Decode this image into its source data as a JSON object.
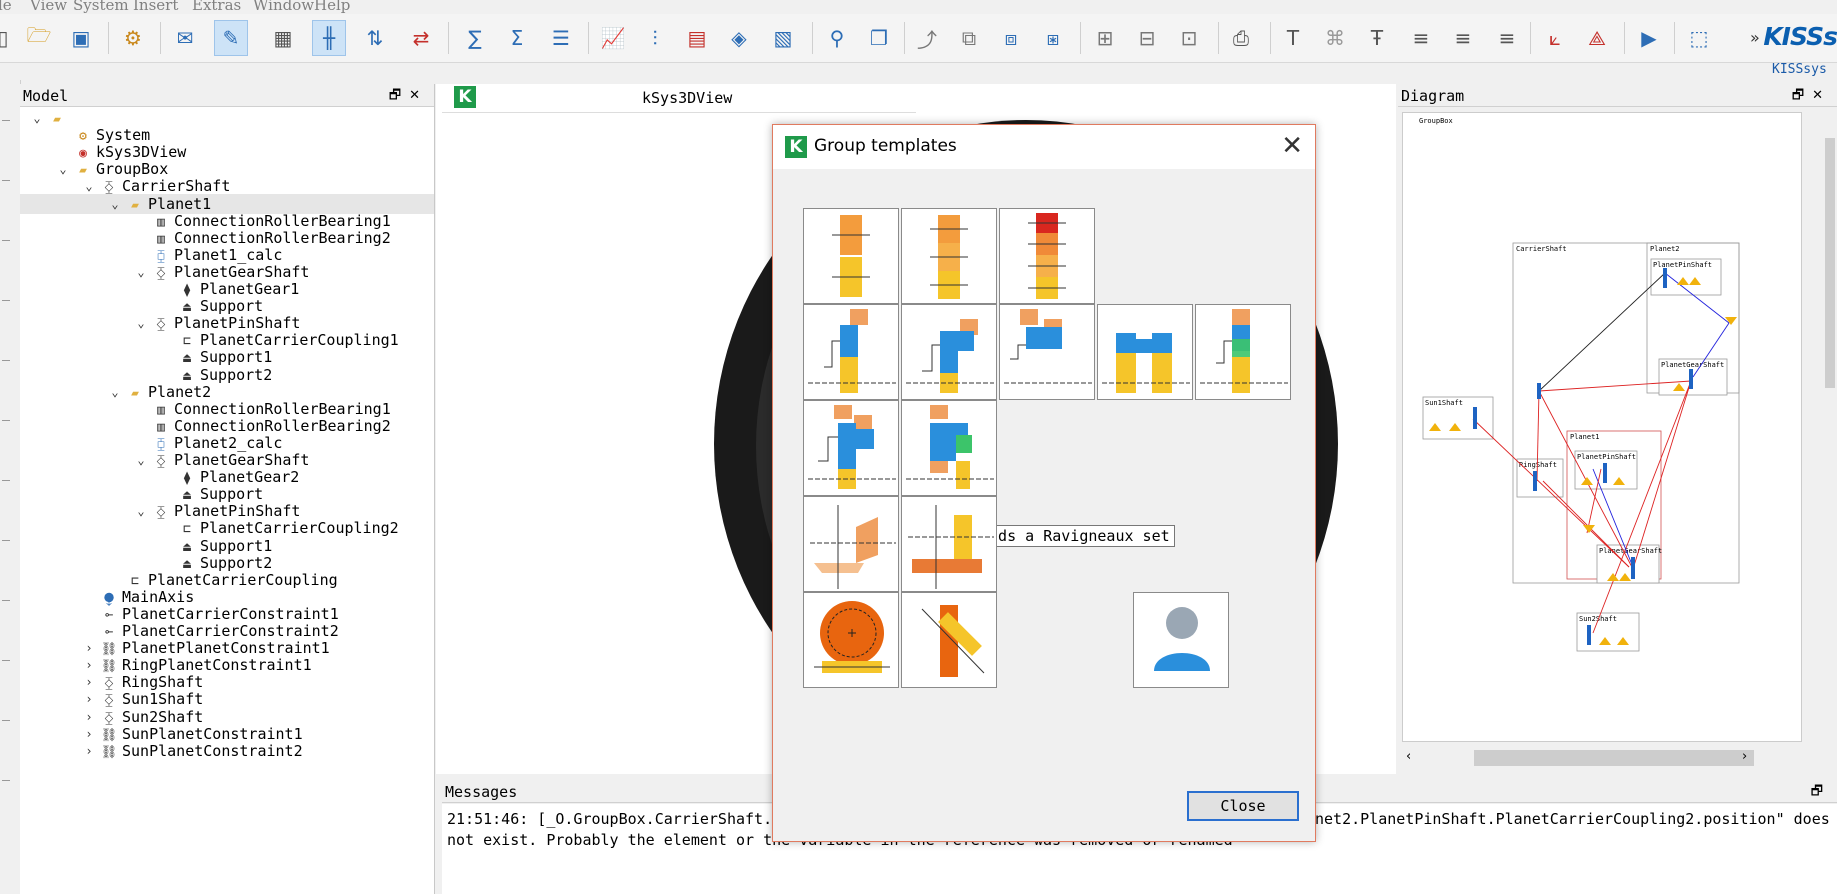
{
  "menu": [
    "le",
    "View",
    "System",
    "Insert",
    "Extras",
    "Window",
    "Help"
  ],
  "brand": {
    "logo": "KISSs",
    "subtitle": "KISSsys"
  },
  "toolbar": {
    "more": "»"
  },
  "model_panel": {
    "title": "Model",
    "tree": [
      {
        "label": "",
        "icon": "folder-icon",
        "level": 0,
        "chevron": "down",
        "kind": "root"
      },
      {
        "label": "System",
        "icon": "gears-icon",
        "level": 1
      },
      {
        "label": "kSys3DView",
        "icon": "view3d-icon",
        "level": 1
      },
      {
        "label": "GroupBox",
        "icon": "folder-icon",
        "level": 1,
        "chevron": "down"
      },
      {
        "label": "CarrierShaft",
        "icon": "shaft-icon",
        "level": 2,
        "chevron": "down"
      },
      {
        "label": "Planet1",
        "icon": "folder-icon",
        "level": 3,
        "chevron": "down",
        "selected": true
      },
      {
        "label": "ConnectionRollerBearing1",
        "icon": "bearing-icon",
        "level": 4
      },
      {
        "label": "ConnectionRollerBearing2",
        "icon": "bearing-icon",
        "level": 4
      },
      {
        "label": "Planet1_calc",
        "icon": "calc-icon",
        "level": 4
      },
      {
        "label": "PlanetGearShaft",
        "icon": "shaft-icon",
        "level": 4,
        "chevron": "down"
      },
      {
        "label": "PlanetGear1",
        "icon": "gear-icon",
        "level": 5
      },
      {
        "label": "Support",
        "icon": "support-icon",
        "level": 5
      },
      {
        "label": "PlanetPinShaft",
        "icon": "shaft-icon",
        "level": 4,
        "chevron": "down"
      },
      {
        "label": "PlanetCarrierCoupling1",
        "icon": "coupling-icon",
        "level": 5
      },
      {
        "label": "Support1",
        "icon": "support-icon",
        "level": 5
      },
      {
        "label": "Support2",
        "icon": "support-icon",
        "level": 5
      },
      {
        "label": "Planet2",
        "icon": "folder-icon",
        "level": 3,
        "chevron": "down"
      },
      {
        "label": "ConnectionRollerBearing1",
        "icon": "bearing-icon",
        "level": 4
      },
      {
        "label": "ConnectionRollerBearing2",
        "icon": "bearing-icon",
        "level": 4
      },
      {
        "label": "Planet2_calc",
        "icon": "calc-icon",
        "level": 4
      },
      {
        "label": "PlanetGearShaft",
        "icon": "shaft-icon",
        "level": 4,
        "chevron": "down"
      },
      {
        "label": "PlanetGear2",
        "icon": "gear-icon",
        "level": 5
      },
      {
        "label": "Support",
        "icon": "support-icon",
        "level": 5
      },
      {
        "label": "PlanetPinShaft",
        "icon": "shaft-icon",
        "level": 4,
        "chevron": "down"
      },
      {
        "label": "PlanetCarrierCoupling2",
        "icon": "coupling-icon",
        "level": 5
      },
      {
        "label": "Support1",
        "icon": "support-icon",
        "level": 5
      },
      {
        "label": "Support2",
        "icon": "support-icon",
        "level": 5
      },
      {
        "label": "PlanetCarrierCoupling",
        "icon": "coupling-icon",
        "level": 3
      },
      {
        "label": "MainAxis",
        "icon": "axis-icon",
        "level": 2
      },
      {
        "label": "PlanetCarrierConstraint1",
        "icon": "constraint-icon",
        "level": 2
      },
      {
        "label": "PlanetCarrierConstraint2",
        "icon": "constraint-icon",
        "level": 2
      },
      {
        "label": "PlanetPlanetConstraint1",
        "icon": "constraint-group-icon",
        "level": 2,
        "chevron": "right"
      },
      {
        "label": "RingPlanetConstraint1",
        "icon": "constraint-group-icon",
        "level": 2,
        "chevron": "right"
      },
      {
        "label": "RingShaft",
        "icon": "shaft-icon",
        "level": 2,
        "chevron": "right"
      },
      {
        "label": "Sun1Shaft",
        "icon": "shaft-icon",
        "level": 2,
        "chevron": "right"
      },
      {
        "label": "Sun2Shaft",
        "icon": "shaft-icon",
        "level": 2,
        "chevron": "right"
      },
      {
        "label": "SunPlanetConstraint1",
        "icon": "constraint-group-icon",
        "level": 2,
        "chevron": "right"
      },
      {
        "label": "SunPlanetConstraint2",
        "icon": "constraint-group-icon",
        "level": 2,
        "chevron": "right"
      }
    ]
  },
  "view3d": {
    "tab_label": "kSys3DView"
  },
  "diagram_panel": {
    "title": "Diagram",
    "labels": [
      "GroupBox",
      "CarrierShaft",
      "Planet2",
      "PlanetPinShaft",
      "PlanetGearShaft",
      "Sun1Shaft",
      "Planet1",
      "RingShaft",
      "PlanetPinShaft",
      "PlanetGearShaft",
      "Sun2Shaft"
    ]
  },
  "messages": {
    "title": "Messages",
    "line1_left": "21:51:46: [_O.GroupBox.CarrierShaft.",
    "line1_right": "net2.PlanetPinShaft.PlanetCarrierCoupling2.position\" does",
    "line2": "not exist. Probably the element or the variable in the reference was removed or renamed"
  },
  "dialog": {
    "title": "Group templates",
    "tooltip": "Adds a Ravigneaux set",
    "close_label": "Close",
    "templates": [
      "gear-pair-template",
      "gear-train-3-template",
      "gear-train-4-template",
      "planetary-stage-template",
      "planetary-stage-carrier-template",
      "planetary-stage-ring-template",
      "double-planet-template",
      "planetary-coupled-template",
      "compound-planetary-template",
      "ravigneaux-set-template",
      "bevel-gear-template",
      "face-gear-template",
      "worm-gear-template",
      "crossed-helical-template",
      "user-template"
    ]
  },
  "colors": {
    "accent": "#2a6fcf",
    "k_green": "#1f9a4a",
    "dialog_border": "#e07a5f"
  }
}
